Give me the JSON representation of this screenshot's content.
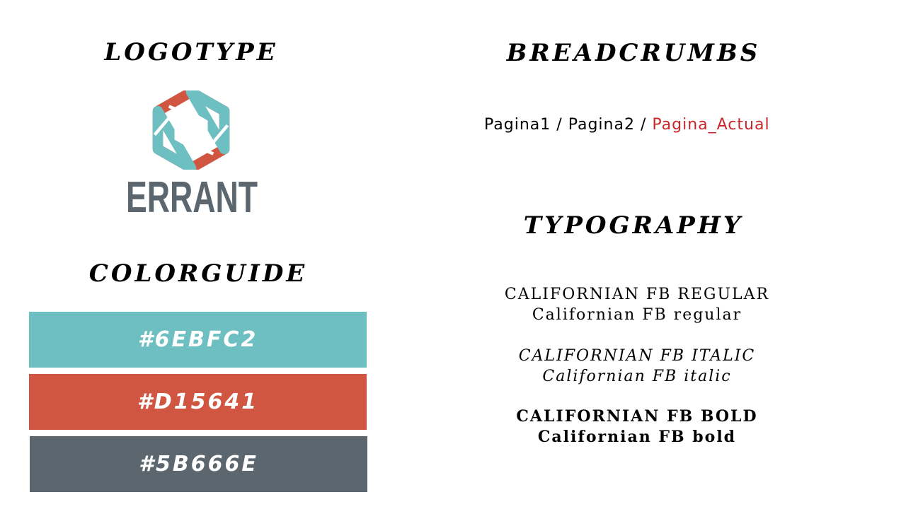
{
  "headings": {
    "logotype": "LOGOTYPE",
    "colorguide": "COLORGUIDE",
    "breadcrumbs": "BREADCRUMBS",
    "typography": "TYPOGRAPHY"
  },
  "logo": {
    "wordmark": "ERRANT",
    "colors": {
      "teal": "#6EBFC2",
      "red": "#D15641",
      "gray": "#5B666E"
    }
  },
  "colorguide": [
    {
      "label": "#6EBFC2",
      "color": "#6EBFC2"
    },
    {
      "label": "#D15641",
      "color": "#D15641"
    },
    {
      "label": "#5B666E",
      "color": "#5B666E"
    }
  ],
  "breadcrumb": {
    "page1": "Pagina1",
    "page2": "Pagina2",
    "current": "Pagina_Actual",
    "separator": "/",
    "current_color": "#C9262B"
  },
  "typography": {
    "regular_upper": "CALIFORNIAN FB REGULAR",
    "regular_lower": "Californian FB regular",
    "italic_upper": "CALIFORNIAN FB ITALIC",
    "italic_lower": "Californian FB italic",
    "bold_upper": "CALIFORNIAN FB BOLD",
    "bold_lower": "Californian FB bold"
  }
}
